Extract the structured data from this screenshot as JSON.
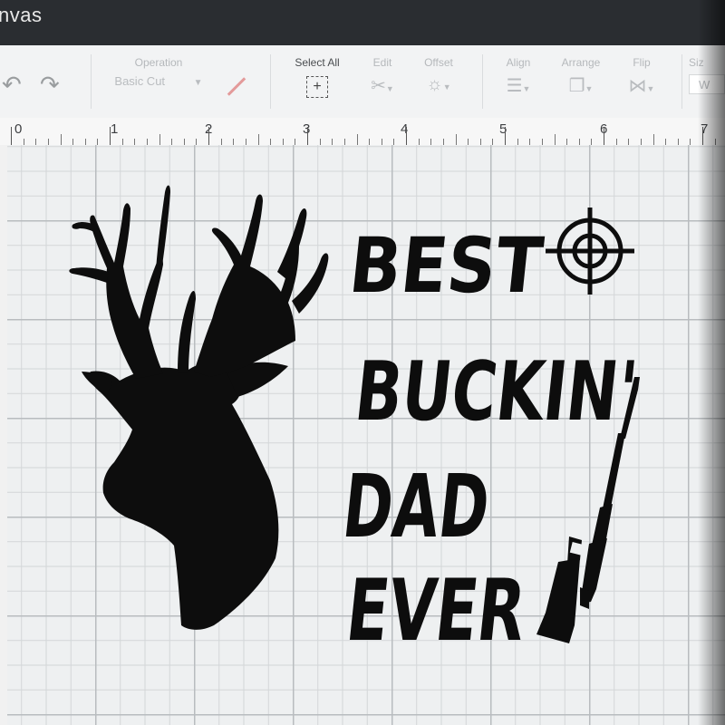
{
  "window": {
    "title": "nvas"
  },
  "toolbar": {
    "operation": {
      "label": "Operation",
      "value": "Basic Cut"
    },
    "select_all": {
      "label": "Select All"
    },
    "edit": {
      "label": "Edit"
    },
    "offset": {
      "label": "Offset"
    },
    "align": {
      "label": "Align"
    },
    "arrange": {
      "label": "Arrange"
    },
    "flip": {
      "label": "Flip"
    },
    "size": {
      "label": "Siz",
      "w_label": "W"
    }
  },
  "ruler": {
    "numbers": [
      "0",
      "1",
      "2",
      "3",
      "4",
      "5",
      "6",
      "7"
    ]
  },
  "design": {
    "line1": "BEST",
    "line2": "BUCKIN'",
    "line3": "DAD",
    "line4": "EVER"
  },
  "colors": {
    "ink": "#0d0d0d",
    "grid": "#d3d6d8",
    "canvas": "#eef0f1"
  }
}
